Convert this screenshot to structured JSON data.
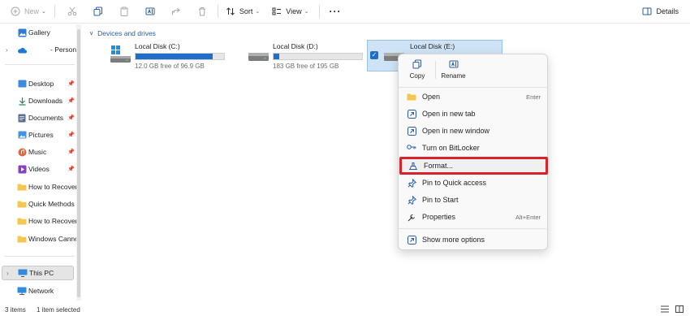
{
  "toolbar": {
    "new_label": "New",
    "sort_label": "Sort",
    "view_label": "View",
    "more_label": "···",
    "details_label": "Details"
  },
  "sidebar": {
    "items": [
      {
        "label": "Gallery",
        "icon": "gallery-icon"
      },
      {
        "label": "- Person",
        "icon": "onedrive-icon"
      },
      {
        "label": "Desktop",
        "icon": "desktop-icon",
        "pinned": true
      },
      {
        "label": "Downloads",
        "icon": "downloads-icon",
        "pinned": true
      },
      {
        "label": "Documents",
        "icon": "documents-icon",
        "pinned": true
      },
      {
        "label": "Pictures",
        "icon": "pictures-icon",
        "pinned": true
      },
      {
        "label": "Music",
        "icon": "music-icon",
        "pinned": true
      },
      {
        "label": "Videos",
        "icon": "videos-icon",
        "pinned": true
      },
      {
        "label": "How to Recover",
        "icon": "folder-icon"
      },
      {
        "label": "Quick Methods",
        "icon": "folder-icon"
      },
      {
        "label": "How to Recover",
        "icon": "folder-icon"
      },
      {
        "label": "Windows Canno",
        "icon": "folder-icon"
      },
      {
        "label": "This PC",
        "icon": "pc-icon"
      },
      {
        "label": "Network",
        "icon": "network-icon"
      }
    ]
  },
  "main": {
    "group_title": "Devices and drives",
    "drives": [
      {
        "name": "Local Disk (C:)",
        "free_text": "12.0 GB free of 96.9 GB",
        "used_fraction": 0.876
      },
      {
        "name": "Local Disk (D:)",
        "free_text": "183 GB free of 195 GB",
        "used_fraction": 0.062
      },
      {
        "name": "Local Disk (E:)",
        "free_text": "",
        "used_fraction": 0
      }
    ]
  },
  "context_menu": {
    "copy_label": "Copy",
    "rename_label": "Rename",
    "items": [
      {
        "label": "Open",
        "shortcut": "Enter"
      },
      {
        "label": "Open in new tab",
        "shortcut": ""
      },
      {
        "label": "Open in new window",
        "shortcut": ""
      },
      {
        "label": "Turn on BitLocker",
        "shortcut": ""
      },
      {
        "label": "Format...",
        "shortcut": ""
      },
      {
        "label": "Pin to Quick access",
        "shortcut": ""
      },
      {
        "label": "Pin to Start",
        "shortcut": ""
      },
      {
        "label": "Properties",
        "shortcut": "Alt+Enter"
      },
      {
        "label": "Show more options",
        "shortcut": ""
      }
    ]
  },
  "status": {
    "items_count": "3 items",
    "selection": "1 item selected"
  },
  "colors": {
    "accent": "#1f6fc8",
    "highlight_border": "#d8222a",
    "group_header": "#2a5ca8"
  }
}
